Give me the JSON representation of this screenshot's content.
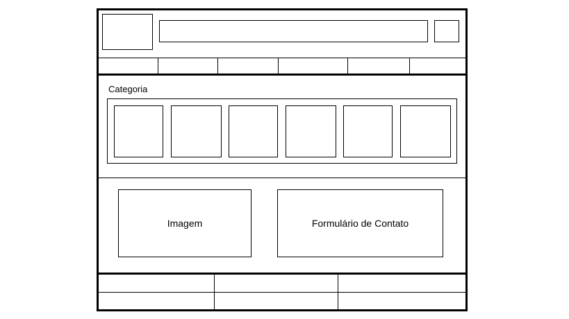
{
  "category_section": {
    "title": "Categoria"
  },
  "content_section": {
    "image_label": "Imagem",
    "contact_form_label": "Formulário de Contato"
  }
}
